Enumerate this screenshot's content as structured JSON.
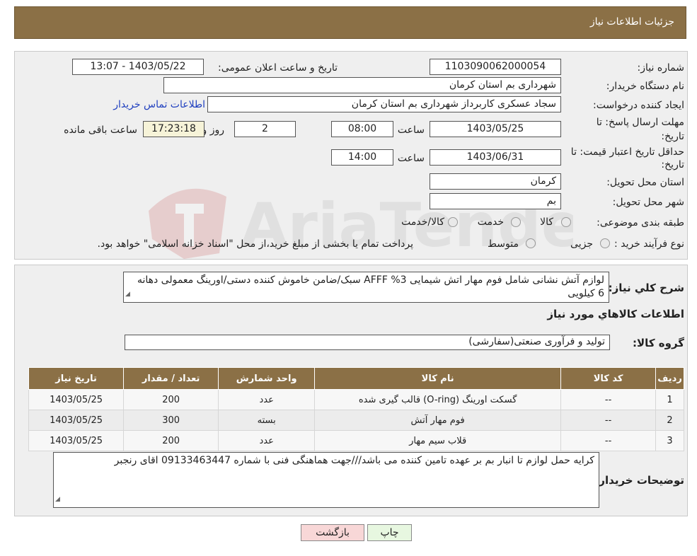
{
  "header": {
    "title": "جزئیات اطلاعات نیاز"
  },
  "info": {
    "need_number_label": "شماره نیاز:",
    "need_number": "1103090062000054",
    "announce_label": "تاریخ و ساعت اعلان عمومی:",
    "announce_value": "1403/05/22 - 13:07",
    "buyer_org_label": "نام دستگاه خریدار:",
    "buyer_org": "شهرداری بم استان کرمان",
    "creator_label": "ایجاد کننده درخواست:",
    "creator": "سجاد عسکری کاربرداز شهرداری بم استان کرمان",
    "contact_link": "اطلاعات تماس خریدار",
    "deadline_label_1": "مهلت ارسال پاسخ: تا",
    "deadline_label_2": "تاریخ:",
    "deadline_date": "1403/05/25",
    "time_label": "ساعت",
    "deadline_time": "08:00",
    "days_value": "2",
    "days_label": "روز و",
    "remaining_time": "17:23:18",
    "remaining_label": "ساعت باقی مانده",
    "validity_label_1": "حداقل تاریخ اعتبار قیمت: تا",
    "validity_label_2": "تاریخ:",
    "validity_date": "1403/06/31",
    "validity_time_label": "ساعت",
    "validity_time": "14:00",
    "province_label": "استان محل تحویل:",
    "province": "کرمان",
    "city_label": "شهر محل تحویل:",
    "city": "بم",
    "category_label": "طبقه بندی موضوعی:",
    "category_options": [
      "کالا",
      "خدمت",
      "کالا/خدمت"
    ],
    "process_label": "نوع فرآیند خرید :",
    "process_options": [
      "جزیی",
      "متوسط"
    ],
    "process_note": "پرداخت تمام یا بخشی از مبلغ خرید،از محل \"اسناد خزانه اسلامی\" خواهد بود."
  },
  "description": {
    "label": "شرح کلي نياز:",
    "text": "لوازم آتش نشانی شامل فوم مهار اتش شیمایی AFFF %3 سبک/ضامن خاموش کننده دستی/اورینگ معمولی دهانه 6 کیلویی"
  },
  "goods": {
    "title": "اطلاعات کالاهاي مورد نياز",
    "group_label": "گروه کالا:",
    "group_value": "تولید و فرآوری صنعتی(سفارشی)",
    "columns": [
      "رديف",
      "کد کالا",
      "نام کالا",
      "واحد شمارش",
      "تعداد / مقدار",
      "تاريخ نياز"
    ],
    "rows": [
      [
        "1",
        "--",
        "گسکت اورینگ (O-ring) قالب گیری شده",
        "عدد",
        "200",
        "1403/05/25"
      ],
      [
        "2",
        "--",
        "فوم مهار آتش",
        "بسته",
        "300",
        "1403/05/25"
      ],
      [
        "3",
        "--",
        "قلاب سیم مهار",
        "عدد",
        "200",
        "1403/05/25"
      ]
    ]
  },
  "buyer_notes": {
    "label": "توضیحات خریدار:",
    "text": "کرایه حمل لوازم تا انبار بم بر عهده تامین کننده می باشد///جهت هماهنگی فنی با شماره 09133463447 اقای رنجبر"
  },
  "buttons": {
    "print": "چاپ",
    "back": "بازگشت"
  },
  "watermark": {
    "text": "AriaTender.neT"
  },
  "colors": {
    "header": "#8b7046",
    "link": "#1f3fbf",
    "back_button": "#f8d7d7",
    "print_button": "#e7f7e0"
  }
}
